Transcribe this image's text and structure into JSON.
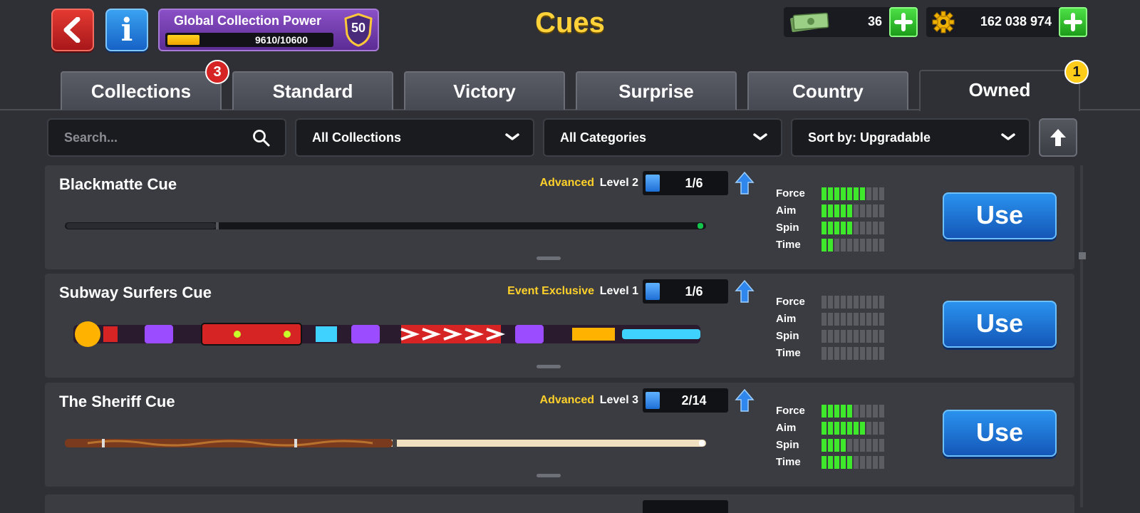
{
  "header": {
    "title": "Cues",
    "back_icon": "back-arrow-icon",
    "info_icon": "info-icon",
    "info_label": "i",
    "collection_power": {
      "title": "Global Collection Power",
      "progress_text": "9610/10600",
      "progress_fraction": 0.9066,
      "level": "50"
    },
    "cash": {
      "icon": "cash-icon",
      "value": "36"
    },
    "coins": {
      "icon": "gear-coin-icon",
      "value": "162 038 974"
    }
  },
  "tabs": [
    {
      "label": "Collections",
      "badge": "3"
    },
    {
      "label": "Standard"
    },
    {
      "label": "Victory"
    },
    {
      "label": "Surprise"
    },
    {
      "label": "Country"
    },
    {
      "label": "Owned",
      "badge": "1",
      "active": true
    }
  ],
  "filters": {
    "search_placeholder": "Search...",
    "collections": "All Collections",
    "categories": "All Categories",
    "sort": "Sort by: Upgradable"
  },
  "stat_labels": {
    "force": "Force",
    "aim": "Aim",
    "spin": "Spin",
    "time": "Time"
  },
  "cues": [
    {
      "name": "Blackmatte Cue",
      "rarity": "Advanced",
      "level": "Level 2",
      "progress": "1/6",
      "stats": {
        "force": 7,
        "aim": 5,
        "spin": 5,
        "time": 2
      },
      "use_label": "Use",
      "colors": [
        "#15161a",
        "#2a2b30",
        "#12c44a"
      ]
    },
    {
      "name": "Subway Surfers Cue",
      "rarity": "Event Exclusive",
      "level": "Level 1",
      "progress": "1/6",
      "stats": {
        "force": 0,
        "aim": 0,
        "spin": 0,
        "time": 0
      },
      "use_label": "Use",
      "colors": [
        "#ffb300",
        "#d62424",
        "#3fd2ff",
        "#9c4cff",
        "#ffffff"
      ]
    },
    {
      "name": "The Sheriff Cue",
      "rarity": "Advanced",
      "level": "Level 3",
      "progress": "2/14",
      "stats": {
        "force": 5,
        "aim": 7,
        "spin": 4,
        "time": 5
      },
      "use_label": "Use",
      "colors": [
        "#7a3a1e",
        "#b8722e",
        "#f0e0c0"
      ]
    }
  ]
}
